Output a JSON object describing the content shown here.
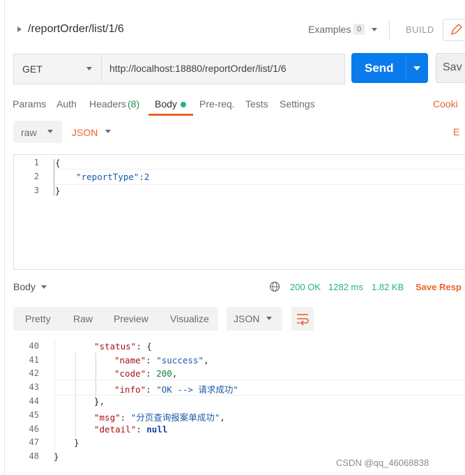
{
  "request": {
    "title": "/reportOrder/list/1/6",
    "examples_label": "Examples",
    "examples_count": "0",
    "build_label": "BUILD"
  },
  "url_bar": {
    "method": "GET",
    "url": "http://localhost:18880/reportOrder/list/1/6",
    "send_label": "Send",
    "save_label": "Sav"
  },
  "request_tabs": {
    "params": "Params",
    "auth": "Auth",
    "headers": "Headers",
    "headers_count": "(8)",
    "body": "Body",
    "prereq": "Pre-req.",
    "tests": "Tests",
    "settings": "Settings",
    "cookies": "Cooki"
  },
  "body_options": {
    "mode": "raw",
    "format": "JSON",
    "beautify": "E"
  },
  "request_editor": {
    "line_numbers": [
      "1",
      "2",
      "3"
    ],
    "lines": [
      "{",
      "    \"reportType\":2",
      "}"
    ]
  },
  "response_bar": {
    "label": "Body",
    "status": "200 OK",
    "time": "1282 ms",
    "size": "1.82 KB",
    "save_label": "Save Resp"
  },
  "response_view": {
    "tabs": [
      "Pretty",
      "Raw",
      "Preview",
      "Visualize"
    ],
    "format": "JSON"
  },
  "response_code": {
    "line_numbers": [
      "40",
      "41",
      "42",
      "43",
      "44",
      "45",
      "46",
      "47",
      "48"
    ],
    "status_key": "\"status\"",
    "name_key": "\"name\"",
    "name_val": "\"success\"",
    "code_key": "\"code\"",
    "code_val": "200",
    "info_key": "\"info\"",
    "info_val": "\"OK --> 请求成功\"",
    "msg_key": "\"msg\"",
    "msg_val": "\"分页查询报案单成功\"",
    "detail_key": "\"detail\"",
    "detail_val": "null"
  },
  "watermark": "CSDN @qq_46068838",
  "colors": {
    "send": "#097bed",
    "status_ok": "#26b47f",
    "accent_orange": "#e8642a"
  }
}
